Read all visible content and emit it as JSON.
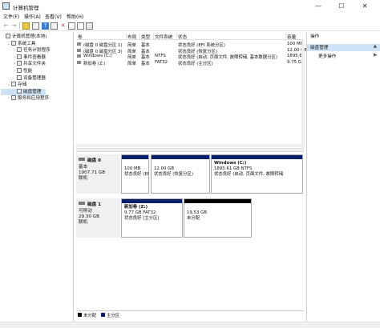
{
  "window": {
    "title": "计算机管理",
    "minimize": "—",
    "maximize": "☐",
    "close": "✕"
  },
  "menu": [
    "文件(F)",
    "操作(A)",
    "查看(V)",
    "帮助(H)"
  ],
  "toolbar": {
    "back": "←",
    "forward": "→"
  },
  "tree": [
    {
      "label": "计算机管理(本地)",
      "arrow": "",
      "indent": 0
    },
    {
      "label": "系统工具",
      "arrow": "⌄",
      "indent": 1
    },
    {
      "label": "任务计划程序",
      "arrow": "›",
      "indent": 2
    },
    {
      "label": "事件查看器",
      "arrow": "›",
      "indent": 2
    },
    {
      "label": "共享文件夹",
      "arrow": "›",
      "indent": 2
    },
    {
      "label": "性能",
      "arrow": "›",
      "indent": 2
    },
    {
      "label": "设备管理器",
      "arrow": "",
      "indent": 2
    },
    {
      "label": "存储",
      "arrow": "⌄",
      "indent": 1
    },
    {
      "label": "磁盘管理",
      "arrow": "",
      "indent": 2,
      "selected": true
    },
    {
      "label": "服务和应用程序",
      "arrow": "›",
      "indent": 1
    }
  ],
  "volume_table": {
    "headers": [
      "卷",
      "布局",
      "类型",
      "文件系统",
      "状态",
      "容量"
    ],
    "rows": [
      [
        "(磁盘 0 磁盘分区 1)",
        "简单",
        "基本",
        "",
        "状态良好 (EFI 系统分区)",
        "100 MB"
      ],
      [
        "(磁盘 0 磁盘分区 3)",
        "简单",
        "基本",
        "",
        "状态良好 (恢复分区)",
        "12.00 GB"
      ],
      [
        "Windows (C:)",
        "简单",
        "基本",
        "NTFS",
        "状态良好 (启动, 页面文件, 故障转储, 基本数据分区)",
        "1895.6"
      ],
      [
        "新加卷 (Z:)",
        "简单",
        "基本",
        "FAT32",
        "状态良好 (主分区)",
        "9.75 GE"
      ]
    ]
  },
  "disks": [
    {
      "name": "磁盘 0",
      "type": "基本",
      "size": "1907.71 GB",
      "status": "联机",
      "partitions": [
        {
          "title": "",
          "size": "100 MB",
          "status": "状态良好 (EFI 系统"
        },
        {
          "title": "",
          "size": "12.00 GB",
          "status": "状态良好 (恢复分区)"
        },
        {
          "title": "Windows (C:)",
          "size": "1895.61 GB NTFS",
          "status": "状态良好 (启动, 页面文件, 故障转储"
        }
      ]
    },
    {
      "name": "磁盘 1",
      "type": "可移动",
      "size": "29.30 GB",
      "status": "联机",
      "partitions": [
        {
          "title": "新加卷 (Z:)",
          "size": "9.77 GB FAT32",
          "status": "状态良好 (主分区)"
        },
        {
          "title": "",
          "size": "19.53 GB",
          "status": "未分配"
        }
      ]
    }
  ],
  "legend": [
    {
      "label": "未分配",
      "color": "#000000"
    },
    {
      "label": "主分区",
      "color": "#0a1e6e"
    }
  ],
  "actions": {
    "header": "操作",
    "section": "磁盘管理",
    "more": "更多操作",
    "section_arrow": "▲",
    "more_arrow": "▶"
  },
  "colors": {
    "primary_partition": "#0a1e6e",
    "selection": "#cde3f5",
    "unallocated": "#000000"
  }
}
